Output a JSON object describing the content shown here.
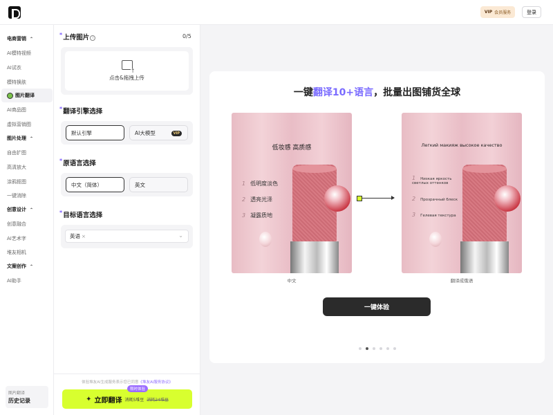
{
  "header": {
    "vip_badge": "VIP",
    "vip_label": "会员服务",
    "login": "登录"
  },
  "sidebar": {
    "groups": [
      {
        "label": "电商营销",
        "items": [
          "AI模特视频",
          "AI试衣",
          "模特换肤",
          "图片翻译",
          "AI商品图",
          "虚拟营销图"
        ]
      },
      {
        "label": "图片处理",
        "items": [
          "自由扩图",
          "高清放大",
          "涂鸦抠图",
          "一键消除"
        ]
      },
      {
        "label": "创意设计",
        "items": [
          "创意融合",
          "AI艺术字",
          "堆友相机"
        ]
      },
      {
        "label": "文案创作",
        "items": [
          "AI助手"
        ]
      }
    ],
    "active_item": "图片翻译",
    "history_small": "图片翻译",
    "history_label": "历史记录"
  },
  "panel": {
    "upload_title": "上传图片",
    "upload_count": "0/5",
    "upload_hint": "点击&拖拽上传",
    "engine_title": "翻译引擎选择",
    "engine_options": [
      "默认引擎",
      "AI大模型"
    ],
    "engine_vip_tag": "VIP",
    "source_title": "原语言选择",
    "source_options": [
      "中文（简体）",
      "英文"
    ],
    "target_title": "目标语言选择",
    "target_selected": "英语",
    "agreement_text": "体验堆友AI生成服务表示您已同意",
    "agreement_link": "《堆友AI服务协议》",
    "translate_button": "立即翻译",
    "translate_cost": "消耗5堆豆",
    "translate_old_cost": "消耗24堆豆",
    "limited_badge": "限时体验"
  },
  "showcase": {
    "title_prefix": "一键",
    "title_highlight": "翻译10+语言",
    "title_suffix": "，批量出图铺货全球",
    "left_image": {
      "headline": "低妆感 高质感",
      "features": [
        {
          "num": "1",
          "text": "低明度淡色"
        },
        {
          "num": "2",
          "text": "透亮光泽"
        },
        {
          "num": "3",
          "text": "凝露质地"
        }
      ],
      "caption": "中文"
    },
    "right_image": {
      "headline": "Легкий макияж   высокое качество",
      "features": [
        {
          "num": "1",
          "text": "Низкая яркость светлых оттенков"
        },
        {
          "num": "2",
          "text": "Прозрачный блеск"
        },
        {
          "num": "3",
          "text": "Гелевая текстура"
        }
      ],
      "caption": "翻译成俄语"
    },
    "try_button": "一键体验",
    "carousel_total": 6,
    "carousel_active": 2
  }
}
